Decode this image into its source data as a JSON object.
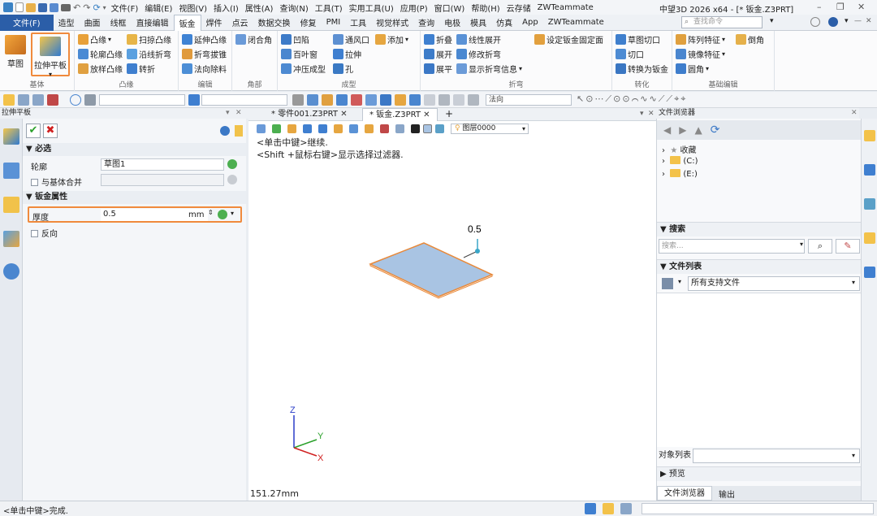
{
  "titlebar": {
    "menu": [
      "文件(F)",
      "编辑(E)",
      "视图(V)",
      "插入(I)",
      "属性(A)",
      "查询(N)",
      "工具(T)",
      "实用工具(U)",
      "应用(P)",
      "窗口(W)",
      "帮助(H)",
      "云存储",
      "ZWTeammate"
    ],
    "title": "中望3D 2026 x64 - [* 钣金.Z3PRT]"
  },
  "tabs": [
    "文件(F)",
    "造型",
    "曲面",
    "线框",
    "直接编辑",
    "钣金",
    "焊件",
    "点云",
    "数据交换",
    "修复",
    "PMI",
    "工具",
    "视觉样式",
    "查询",
    "电极",
    "模具",
    "仿真",
    "App",
    "ZWTeammate"
  ],
  "active_tab": "钣金",
  "search": {
    "placeholder": "查找命令"
  },
  "ribbon": {
    "basic": {
      "sketch": "草图",
      "pull_plate": "拉伸平板",
      "label": "基体"
    },
    "convex": {
      "items": [
        "凸缘",
        "扫掠凸缘",
        "轮廓凸缘",
        "沿线折弯",
        "放样凸缘",
        "转折"
      ],
      "label": "凸缘"
    },
    "edit": {
      "items": [
        "延伸凸缘",
        "折弯拔锥",
        "法向除料"
      ],
      "label": "编辑"
    },
    "corner": {
      "items": [
        "闭合角"
      ],
      "label": "角部"
    },
    "forming": {
      "items": [
        "凹陷",
        "通风口",
        "添加",
        "百叶窗",
        "拉伸",
        "冲压成型",
        "孔"
      ],
      "label": "成型"
    },
    "bend": {
      "items": [
        "折叠",
        "线性展开",
        "设定钣金固定面",
        "展开",
        "修改折弯",
        "展平",
        "显示折弯信息"
      ],
      "label": "折弯"
    },
    "convert": {
      "items": [
        "草图切口",
        "切口",
        "转换为钣金"
      ],
      "label": "转化"
    },
    "basic_edit": {
      "items": [
        "阵列特征",
        "倒角",
        "镜像特征",
        "圆角"
      ],
      "label": "基础编辑"
    }
  },
  "toolbar": {
    "filter_label": "法向"
  },
  "panel": {
    "title": "拉伸平板",
    "required": "必选",
    "profile_label": "轮廓",
    "profile_value": "草图1",
    "merge_label": "与基体合并",
    "sheet_props": "钣金属性",
    "thickness_label": "厚度",
    "thickness_value": "0.5",
    "thickness_unit": "mm",
    "reverse_label": "反向"
  },
  "doc_tabs": [
    "* 零件001.Z3PRT",
    "* 钣金.Z3PRT"
  ],
  "viewport": {
    "layer": "图层0000",
    "hint1": "<单击中键>继续.",
    "hint2": "<Shift +鼠标右键>显示选择过滤器.",
    "dimension": "0.5",
    "scale_text": "151.27mm",
    "axes": {
      "x": "X",
      "y": "Y",
      "z": "Z"
    },
    "sheet_fill": "#a9c4e3",
    "sheet_edge": "#e8893a"
  },
  "file_browser": {
    "title": "文件浏览器",
    "tree": [
      "收藏",
      "(C:)",
      "(E:)"
    ],
    "search_section": "搜索",
    "search_placeholder": "搜索...",
    "file_list": "文件列表",
    "file_filter": "所有支持文件",
    "object_list": "对象列表",
    "preview": "预览",
    "bottom_tabs": [
      "文件浏览器",
      "输出"
    ]
  },
  "status": {
    "text": "<单击中键>完成."
  }
}
